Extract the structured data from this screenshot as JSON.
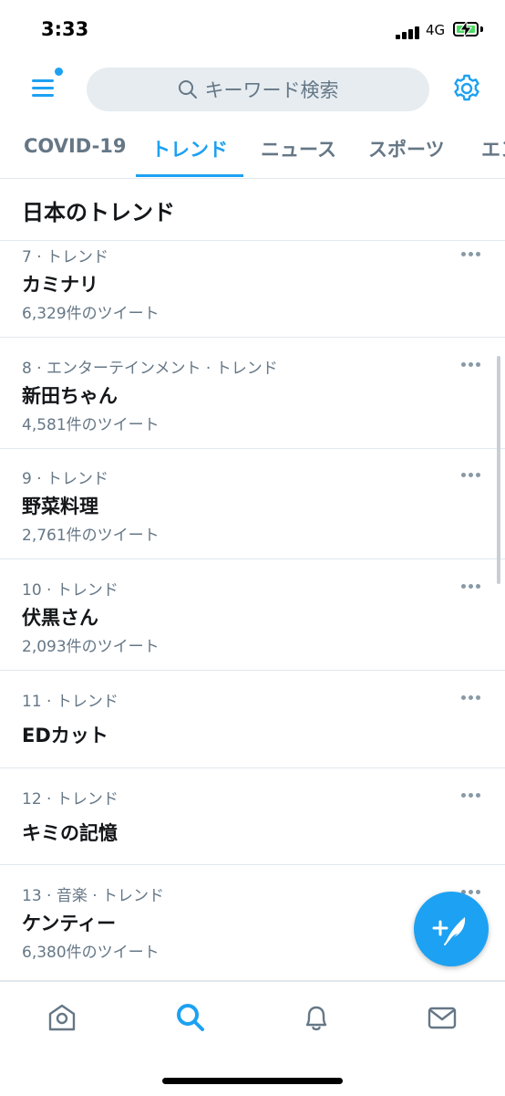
{
  "status": {
    "time": "3:33",
    "network": "4G"
  },
  "header": {
    "search_placeholder": "キーワード検索",
    "icons": [
      "menu-icon",
      "search-icon",
      "gear-icon"
    ]
  },
  "tabs": [
    {
      "label": "COVID-19",
      "active": false
    },
    {
      "label": "トレンド",
      "active": true
    },
    {
      "label": "ニュース",
      "active": false
    },
    {
      "label": "スポーツ",
      "active": false
    },
    {
      "label": "エン",
      "active": false
    }
  ],
  "section": {
    "title": "日本のトレンド"
  },
  "trends": [
    {
      "meta": "7 · トレンド",
      "name": "カミナリ",
      "count": "6,329件のツイート"
    },
    {
      "meta": "8 · エンターテインメント · トレンド",
      "name": "新田ちゃん",
      "count": "4,581件のツイート"
    },
    {
      "meta": "9 · トレンド",
      "name": "野菜料理",
      "count": "2,761件のツイート"
    },
    {
      "meta": "10 · トレンド",
      "name": "伏黒さん",
      "count": "2,093件のツイート"
    },
    {
      "meta": "11 · トレンド",
      "name": "EDカット",
      "count": ""
    },
    {
      "meta": "12 · トレンド",
      "name": "キミの記憶",
      "count": ""
    },
    {
      "meta": "13 · 音楽 · トレンド",
      "name": "ケンティー",
      "count": "6,380件のツイート"
    }
  ],
  "bottom_nav": [
    "home-icon",
    "search-icon",
    "notifications-icon",
    "messages-icon"
  ],
  "colors": {
    "accent": "#1da1f2",
    "text_primary": "#14171a",
    "text_secondary": "#657786",
    "divider": "#e1e8ed",
    "search_bg": "#e6ecf0"
  }
}
